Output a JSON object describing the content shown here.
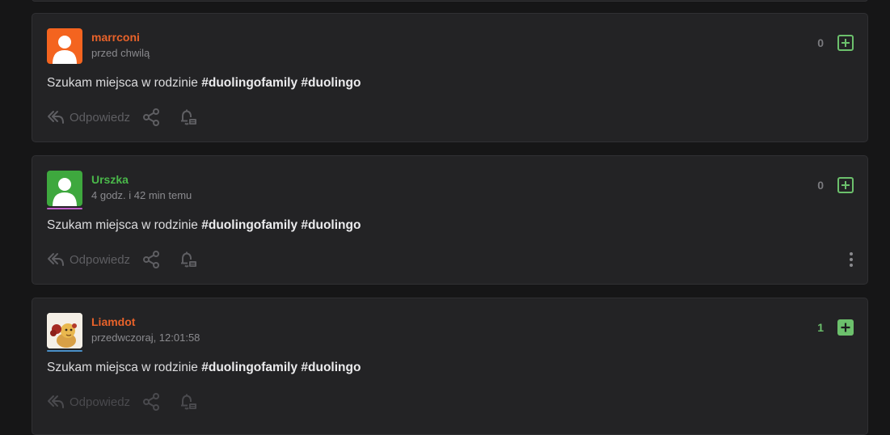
{
  "posts": [
    {
      "username": "marrconi",
      "username_color": "#e8622a",
      "avatar_color": "#f4641f",
      "time": "przed chwilą",
      "content_text": "Szukam miejsca w rodzinie ",
      "tags": [
        "#duolingofamily",
        "#duolingo"
      ],
      "score": "0",
      "reply_label": "Odpowiedz"
    },
    {
      "username": "Urszka",
      "username_color": "#4ab84a",
      "avatar_color": "#3ea83e",
      "underline_color": "#c060c8",
      "time": "4 godz. i 42 min temu",
      "content_text": "Szukam miejsca w rodzinie ",
      "tags": [
        "#duolingofamily",
        "#duolingo"
      ],
      "score": "0",
      "reply_label": "Odpowiedz"
    },
    {
      "username": "Liamdot",
      "username_color": "#e8622a",
      "underline_color": "#4a90c8",
      "time": "przedwczoraj, 12:01:58",
      "content_text": "Szukam miejsca w rodzinie ",
      "tags": [
        "#duolingofamily",
        "#duolingo"
      ],
      "score": "1",
      "score_color": "#6cc06c",
      "reply_label": "Odpowiedz"
    }
  ],
  "icons": {
    "reply": "reply-icon",
    "share": "share-icon",
    "bell": "notify-bell-icon",
    "upvote": "plus-square-icon",
    "more": "more-vertical-icon"
  }
}
